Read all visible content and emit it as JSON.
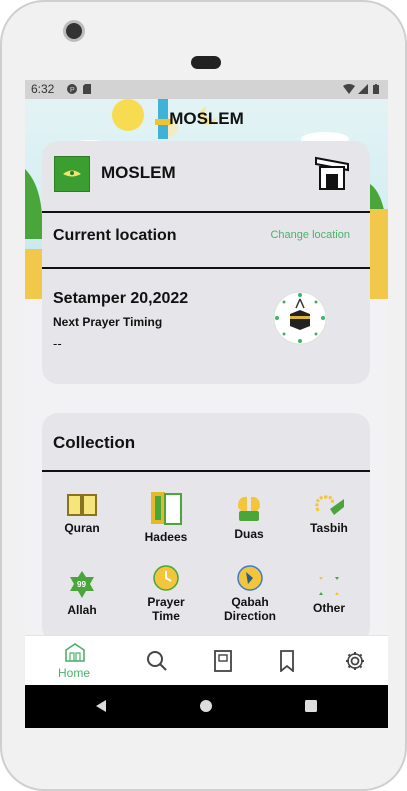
{
  "statusbar": {
    "time": "6:32"
  },
  "header": {
    "title": "MOSLEM"
  },
  "top_card": {
    "app_name": "MOSLEM",
    "location_label": "Current location",
    "change_location_label": "Change location",
    "date": "Setamper 20,2022",
    "next_prayer_label": "Next Prayer Timing",
    "next_prayer_value": "--"
  },
  "collection": {
    "title": "Collection",
    "items": [
      {
        "label": "Quran",
        "icon": "quran-book-icon"
      },
      {
        "label": "Hadees",
        "icon": "hadees-book-icon"
      },
      {
        "label": "Duas",
        "icon": "praying-hands-icon"
      },
      {
        "label": "Tasbih",
        "icon": "tasbih-beads-icon"
      },
      {
        "label": "Allah",
        "icon": "allah-names-icon"
      },
      {
        "label": "Prayer Time",
        "icon": "prayer-clock-icon"
      },
      {
        "label": "Qabah Direction",
        "icon": "compass-icon"
      },
      {
        "label": "Other",
        "icon": "other-dots-icon"
      }
    ]
  },
  "bottom_nav": {
    "home_label": "Home",
    "items": [
      "home-icon",
      "search-icon",
      "book-icon",
      "bookmark-icon",
      "settings-icon"
    ]
  },
  "colors": {
    "accent": "#4cb06b",
    "card": "#e6e6ea",
    "logo": "#3a9e30"
  }
}
